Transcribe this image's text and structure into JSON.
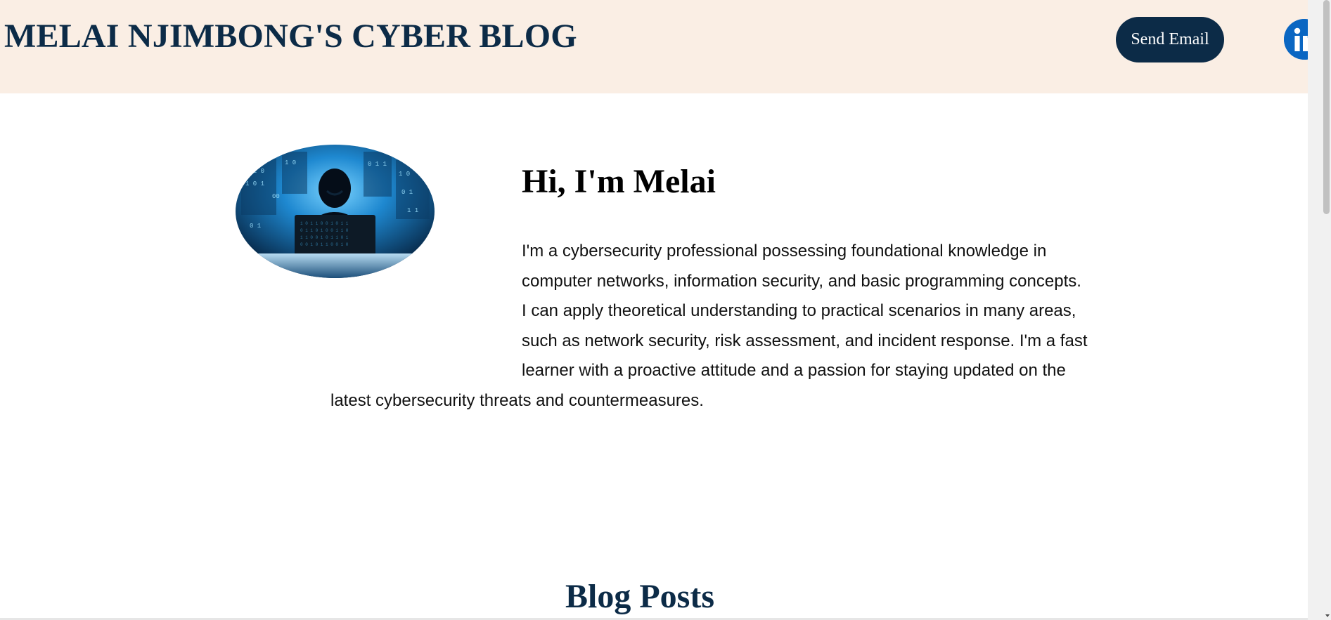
{
  "header": {
    "title": "MELAI NJIMBONG'S CYBER BLOG",
    "send_email_label": "Send Email",
    "linkedin_icon": "linkedin-icon"
  },
  "about": {
    "greeting": "Hi, I'm Melai",
    "bio": "I'm a cybersecurity professional possessing foundational knowledge in computer networks, information security, and basic programming concepts. I can apply theoretical understanding to practical scenarios in many areas, such as network security, risk assessment, and incident response. I'm a fast learner with a proactive attitude and a passion for staying updated on the latest cybersecurity threats and countermeasures.",
    "image": "hooded-hacker-laptop-image"
  },
  "blog": {
    "heading": "Blog Posts"
  },
  "colors": {
    "header_bg": "#faeee4",
    "navy": "#0c2b47",
    "linkedin_blue": "#0a66c2"
  }
}
